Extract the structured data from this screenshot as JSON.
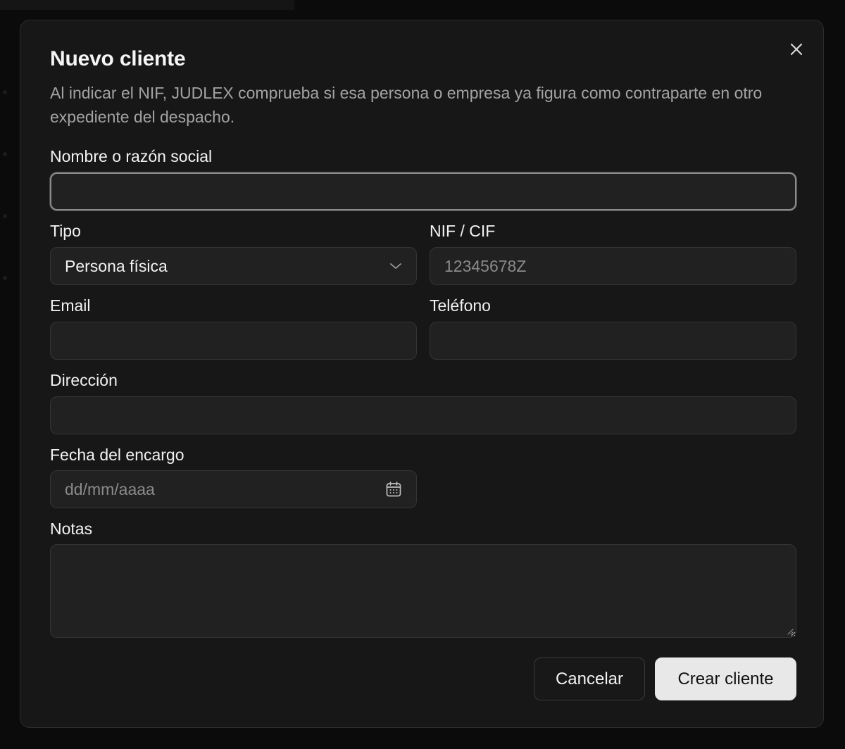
{
  "dialog": {
    "title": "Nuevo cliente",
    "description": "Al indicar el NIF, JUDLEX comprueba si esa persona o empresa ya figura como contraparte en otro expediente del despacho.",
    "close_icon": "close-icon"
  },
  "form": {
    "name": {
      "label": "Nombre o razón social",
      "value": "",
      "placeholder": ""
    },
    "type": {
      "label": "Tipo",
      "value": "Persona física",
      "icon": "chevron-down-icon"
    },
    "nif": {
      "label": "NIF / CIF",
      "value": "",
      "placeholder": "12345678Z"
    },
    "email": {
      "label": "Email",
      "value": "",
      "placeholder": ""
    },
    "phone": {
      "label": "Teléfono",
      "value": "",
      "placeholder": ""
    },
    "address": {
      "label": "Dirección",
      "value": "",
      "placeholder": ""
    },
    "date": {
      "label": "Fecha del encargo",
      "value": "",
      "placeholder": "dd/mm/aaaa",
      "icon": "calendar-icon"
    },
    "notes": {
      "label": "Notas",
      "value": "",
      "placeholder": ""
    }
  },
  "actions": {
    "cancel_label": "Cancelar",
    "submit_label": "Crear cliente"
  },
  "colors": {
    "modal_bg": "#171717",
    "field_bg": "#212121",
    "primary_button_bg": "#e8e8e8",
    "muted_text": "#a3a3a3"
  }
}
